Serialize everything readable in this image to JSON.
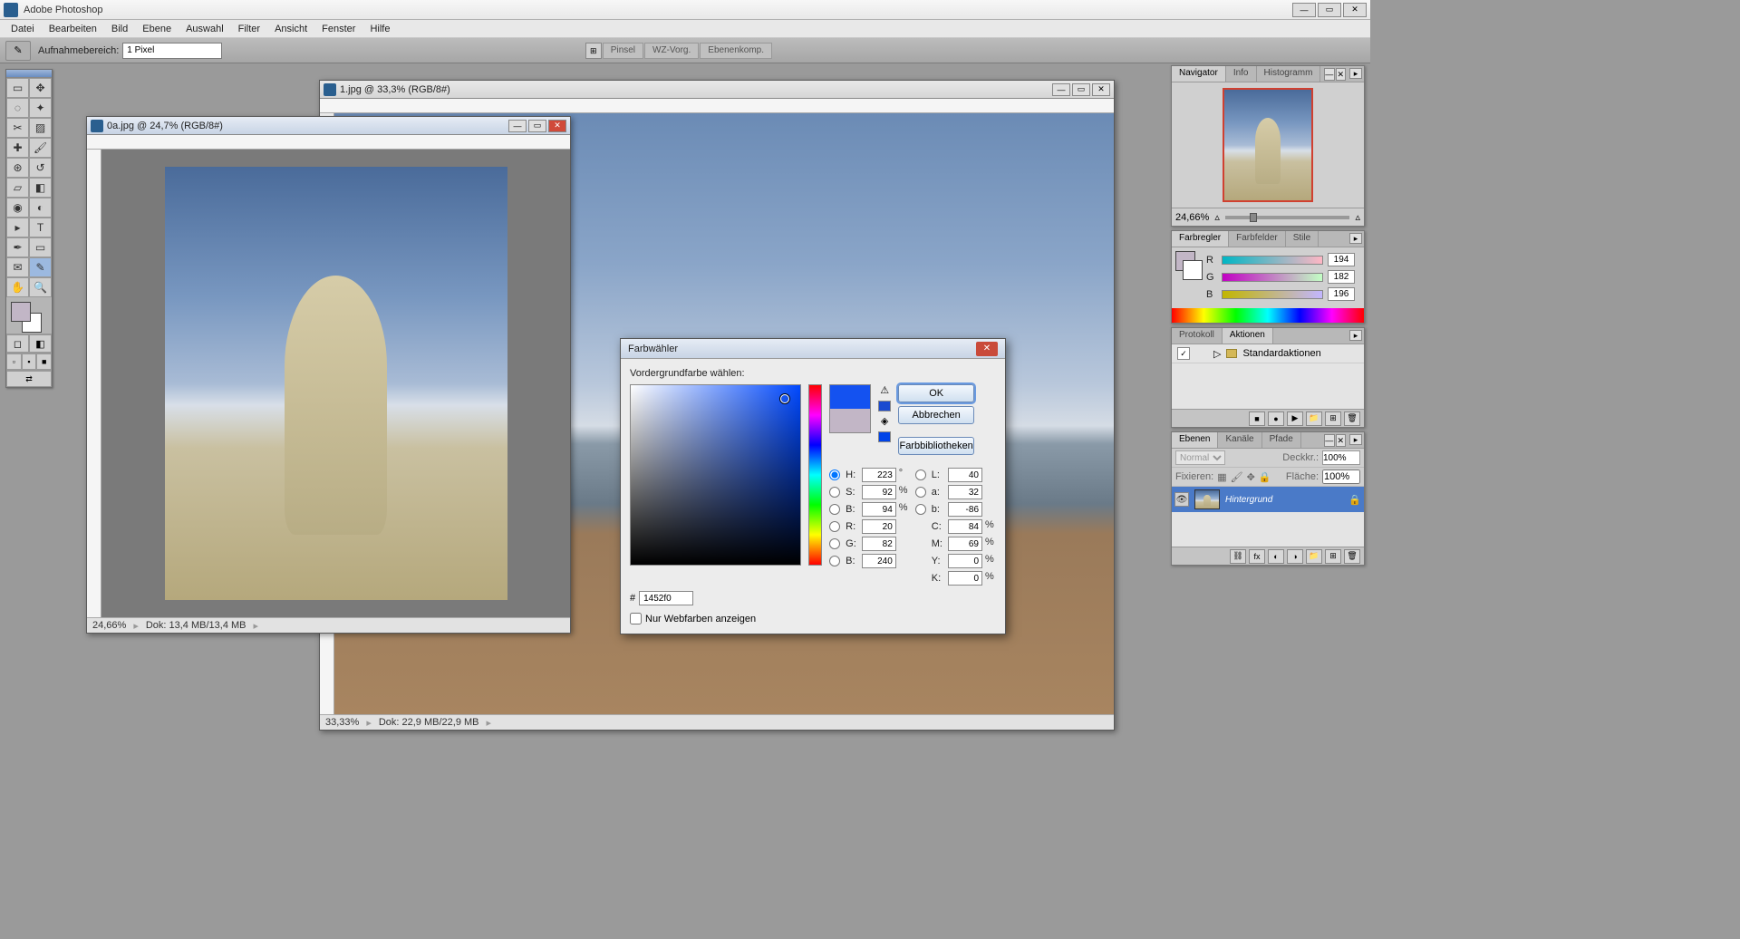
{
  "app": {
    "title": "Adobe Photoshop"
  },
  "menu": [
    "Datei",
    "Bearbeiten",
    "Bild",
    "Ebene",
    "Auswahl",
    "Filter",
    "Ansicht",
    "Fenster",
    "Hilfe"
  ],
  "options_bar": {
    "sample_label": "Aufnahmebereich:",
    "sample_value": "1 Pixel"
  },
  "palette_well": [
    "Pinsel",
    "WZ-Vorg.",
    "Ebenenkomp."
  ],
  "documents": {
    "main": {
      "title": "1.jpg @ 33,3% (RGB/8#)",
      "zoom": "33,33%",
      "status": "Dok: 22,9 MB/22,9 MB"
    },
    "front": {
      "title": "0a.jpg @ 24,7% (RGB/8#)",
      "zoom": "24,66%",
      "status": "Dok: 13,4 MB/13,4 MB"
    }
  },
  "navigator": {
    "tabs": [
      "Navigator",
      "Info",
      "Histogramm"
    ],
    "zoom": "24,66%"
  },
  "color_panel": {
    "tabs": [
      "Farbregler",
      "Farbfelder",
      "Stile"
    ],
    "r": "194",
    "g": "182",
    "b": "196"
  },
  "history_panel": {
    "tabs": [
      "Protokoll",
      "Aktionen"
    ],
    "item": "Standardaktionen"
  },
  "layers_panel": {
    "tabs": [
      "Ebenen",
      "Kanäle",
      "Pfade"
    ],
    "blend": "Normal",
    "opacity_label": "Deckkr.:",
    "opacity": "100%",
    "lock_label": "Fixieren:",
    "fill_label": "Fläche:",
    "fill": "100%",
    "layer_name": "Hintergrund"
  },
  "color_picker": {
    "title": "Farbwähler",
    "heading": "Vordergrundfarbe wählen:",
    "ok": "OK",
    "cancel": "Abbrechen",
    "libraries": "Farbbibliotheken",
    "H": "223",
    "S": "92",
    "Bhsb": "94",
    "L": "40",
    "a": "32",
    "blab": "-86",
    "R": "20",
    "G": "82",
    "Brgb": "240",
    "C": "84",
    "M": "69",
    "Y": "0",
    "K": "0",
    "hex": "1452f0",
    "web_only": "Nur Webfarben anzeigen"
  }
}
